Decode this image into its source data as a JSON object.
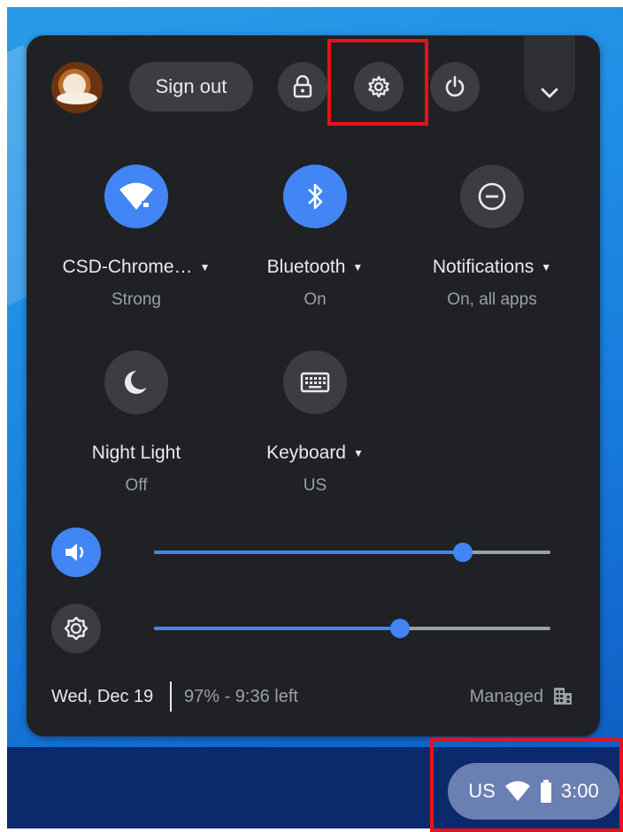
{
  "header": {
    "sign_out_label": "Sign out"
  },
  "pods": [
    {
      "label": "CSD-Chrome…",
      "sublabel": "Strong",
      "icon": "wifi-icon",
      "state": "on"
    },
    {
      "label": "Bluetooth",
      "sublabel": "On",
      "icon": "bluetooth-icon",
      "state": "on"
    },
    {
      "label": "Notifications",
      "sublabel": "On, all apps",
      "icon": "do-not-disturb-icon",
      "state": "off"
    },
    {
      "label": "Night Light",
      "sublabel": "Off",
      "icon": "night-light-icon",
      "state": "off"
    },
    {
      "label": "Keyboard",
      "sublabel": "US",
      "icon": "keyboard-icon",
      "state": "off"
    }
  ],
  "sliders": {
    "volume": {
      "level": 0.78,
      "icon": "volume-icon"
    },
    "brightness": {
      "level": 0.62,
      "icon": "brightness-icon"
    }
  },
  "footer": {
    "date": "Wed, Dec 19",
    "battery": "97% - 9:36 left",
    "managed": "Managed"
  },
  "tray": {
    "input_method": "US",
    "time": "3:00"
  },
  "colors": {
    "panel_bg": "#202124",
    "accent": "#4285f4",
    "button_bg": "#3c3d40",
    "highlight": "#e8121b",
    "tray_bg": "#6a7fb2"
  }
}
